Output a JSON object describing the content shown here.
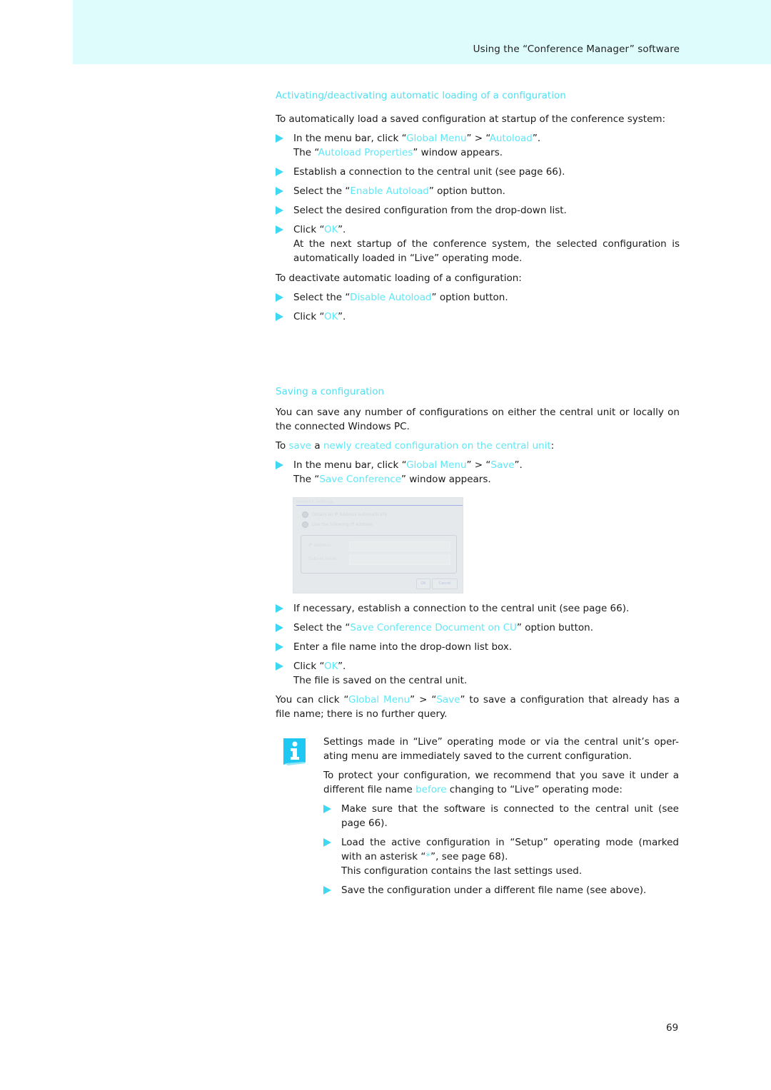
{
  "header": {
    "title": "Using the “Conference Manager” software"
  },
  "colors": {
    "header_band": "#dffcfd",
    "accent": "#5ee8f7",
    "bullet": "#3fd8f2",
    "info_icon": "#1ec8f2"
  },
  "section1": {
    "heading": "Activating/deactivating automatic loading of a configuration",
    "intro": "To automatically load a saved configuration at startup of the conference system:",
    "steps": [
      {
        "parts": [
          "In the menu bar, click “",
          "Global Menu",
          "” > “",
          "Autoload",
          "”."
        ],
        "result_parts": [
          "The “",
          "Autoload Properties",
          "” window appears."
        ]
      },
      {
        "text": "Establish a connection to the central unit (see page 66)."
      },
      {
        "parts": [
          "Select the “",
          "Enable Autoload",
          "” option button."
        ]
      },
      {
        "text": "Select the desired configuration from the drop-down list."
      },
      {
        "parts": [
          "Click “",
          "OK",
          "”."
        ],
        "result": "At the next startup of the conference system, the selected configuration is automatically loaded in “Live” operating mode."
      }
    ],
    "deactivate_intro": "To deactivate automatic loading of a configuration:",
    "deactivate_steps": [
      {
        "parts": [
          "Select the “",
          "Disable Autoload",
          "” option button."
        ]
      },
      {
        "parts": [
          "Click “",
          "OK",
          "”."
        ]
      }
    ]
  },
  "section2": {
    "heading": "Saving a configuration",
    "intro": "You can save any number of configurations on either the central unit or locally on the connected Windows PC.",
    "subintro_parts": [
      "To ",
      "save",
      " a ",
      "newly created configuration on the central unit",
      ":"
    ],
    "steps_a": [
      {
        "parts": [
          "In the menu bar, click “",
          "Global Menu",
          "” > “",
          "Save",
          "”."
        ],
        "result_parts": [
          "The “",
          "Save Conference",
          "” window appears."
        ]
      }
    ],
    "screenshot": {
      "title": "Network Settings",
      "radio_1": "Obtain an IP Address automatically",
      "radio_2": "Use the following IP Address",
      "label_ip": "IP address:",
      "label_subnet": "Subnet mask:",
      "btn_1": "OK",
      "btn_2": "Cancel"
    },
    "steps_b": [
      {
        "text": "If necessary, establish a connection to the central unit (see page 66)."
      },
      {
        "parts": [
          "Select the “",
          "Save Conference Document on CU",
          "” option button."
        ]
      },
      {
        "text": "Enter a file name into the drop-down list box."
      },
      {
        "parts": [
          "Click “",
          "OK",
          "”."
        ],
        "result": "The file is saved on the central unit."
      }
    ],
    "outro_parts": [
      "You can click “",
      "Global Menu",
      "” > “",
      "Save",
      "” to save a configuration that already has a file name; there is no further query."
    ]
  },
  "note": {
    "icon": "info-icon",
    "p1": "Settings made in “Live” operating mode or via the central unit’s oper-ating menu are immediately saved to the current configuration.",
    "p2_parts": [
      "To protect your configuration, we recommend that you save it under a different file name ",
      "before",
      " changing to “Live” operating mode:"
    ],
    "steps": [
      {
        "text": "Make sure that the software is connected to the central unit (see page 66)."
      },
      {
        "parts": [
          "Load the active configuration in “Setup” operating mode (marked with an asterisk “",
          "*",
          "”, see page 68)."
        ],
        "result": "This configuration contains the last settings used."
      },
      {
        "text": "Save the configuration under a different file name (see above)."
      }
    ]
  },
  "footer": {
    "page_number": "69"
  }
}
